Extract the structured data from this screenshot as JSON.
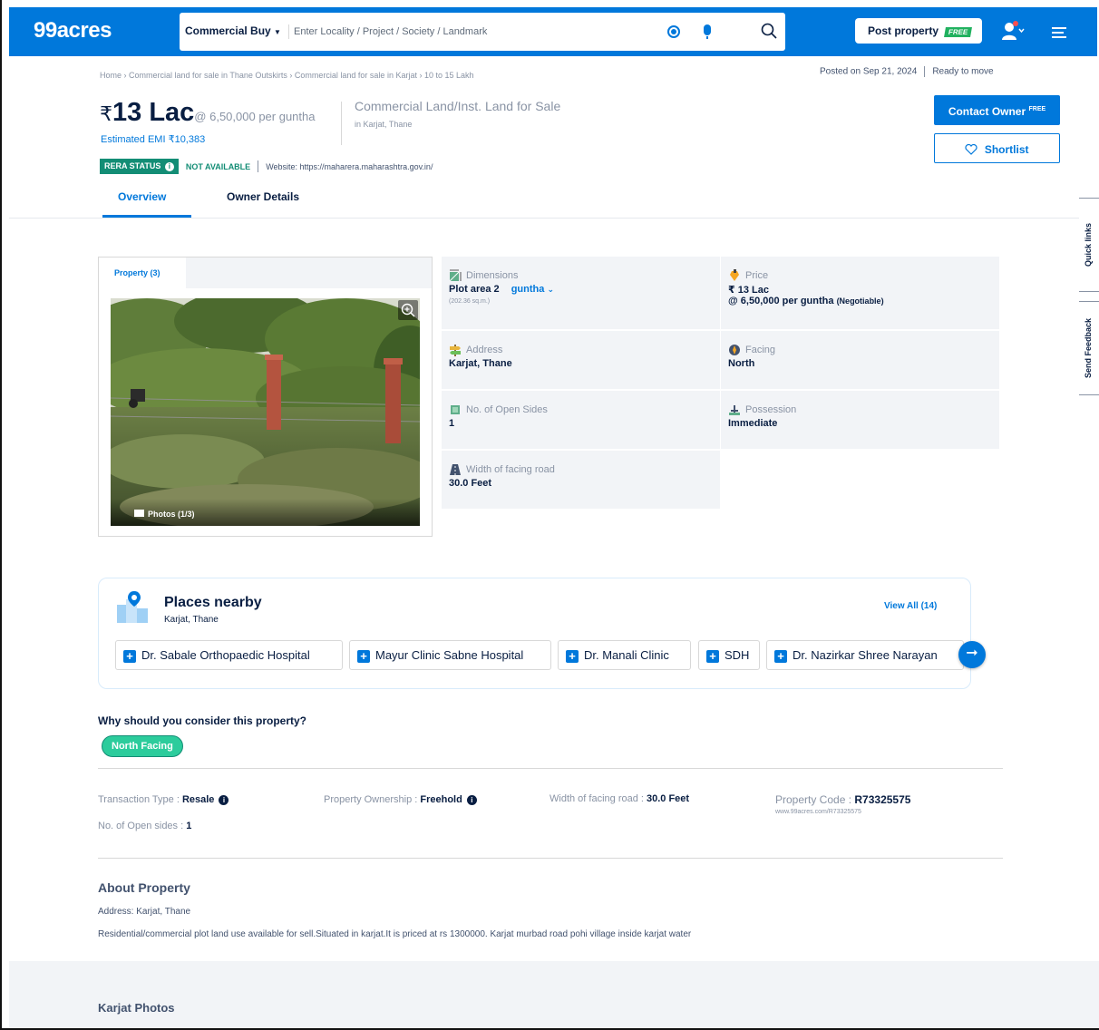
{
  "header": {
    "logo": "99acres",
    "search_type": "Commercial Buy",
    "search_placeholder": "Enter Locality / Project / Society / Landmark",
    "post_property_label": "Post property",
    "post_free_tag": "FREE"
  },
  "breadcrumb": "Home › Commercial land for sale in Thane Outskirts › Commercial land for sale in Karjat › 10 to 15 Lakh",
  "posted": {
    "date": "Posted on Sep 21, 2024",
    "status": "Ready to move"
  },
  "price": {
    "currency": "₹",
    "amount": "13 Lac",
    "rate": "@ 6,50,000 per guntha",
    "emi": "Estimated EMI ₹10,383"
  },
  "property": {
    "title": "Commercial Land/Inst. Land for Sale",
    "location": "in Karjat, Thane"
  },
  "actions": {
    "contact_label": "Contact Owner",
    "contact_tag": "FREE",
    "shortlist_label": "Shortlist"
  },
  "rera": {
    "status_label": "RERA STATUS",
    "info_glyph": "i",
    "availability": "NOT AVAILABLE",
    "website": "Website: https://maharera.maharashtra.gov.in/"
  },
  "tabs": {
    "overview": "Overview",
    "owner": "Owner Details"
  },
  "side_tabs": {
    "quick_links": "Quick links",
    "feedback": "Send Feedback"
  },
  "photos": {
    "tab": "Property (3)",
    "count": "Photos (1/3)"
  },
  "info": {
    "dimensions": {
      "label": "Dimensions",
      "value": "Plot area 2",
      "unit": "guntha",
      "sub": "(202.36 sq.m.)"
    },
    "price": {
      "label": "Price",
      "value": "₹ 13 Lac",
      "sub": "@ 6,50,000 per guntha",
      "neg": "(Negotiable)"
    },
    "address": {
      "label": "Address",
      "value": "Karjat, Thane"
    },
    "facing": {
      "label": "Facing",
      "value": "North"
    },
    "open_sides": {
      "label": "No. of Open Sides",
      "value": "1"
    },
    "possession": {
      "label": "Possession",
      "value": "Immediate"
    },
    "road_width": {
      "label": "Width of facing road",
      "value": "30.0 Feet"
    }
  },
  "nearby": {
    "title": "Places nearby",
    "subtitle": "Karjat, Thane",
    "view_all": "View All (14)",
    "plus_glyph": "+",
    "next_glyph": "➞",
    "places": [
      "Dr. Sabale Orthopaedic Hospital",
      "Mayur Clinic Sabne Hospital",
      "Dr. Manali Clinic",
      "SDH",
      "Dr. Nazirkar Shree Narayan"
    ]
  },
  "why": {
    "title": "Why should you consider this property?",
    "badge": "North Facing"
  },
  "details": {
    "info_glyph": "i",
    "transaction": {
      "label": "Transaction Type : ",
      "value": "Resale"
    },
    "ownership": {
      "label": "Property Ownership : ",
      "value": "Freehold"
    },
    "road": {
      "label": "Width of facing road : ",
      "value": "30.0 Feet"
    },
    "code": {
      "label": "Property Code : ",
      "value": "R73325575",
      "url": "www.99acres.com/R73325575"
    },
    "open_sides": {
      "label": "No. of Open sides : ",
      "value": "1"
    }
  },
  "about": {
    "title": "About Property",
    "address": "Address: Karjat, Thane",
    "description": "Residential/commercial plot land use available for sell.Situated in karjat.It is priced at rs 1300000. Karjat murbad road pohi village inside karjat water"
  },
  "karjat_photos": "Karjat Photos",
  "colors": {
    "brand": "#0078db",
    "green": "#138d75",
    "teal": "#2ccc9c"
  }
}
